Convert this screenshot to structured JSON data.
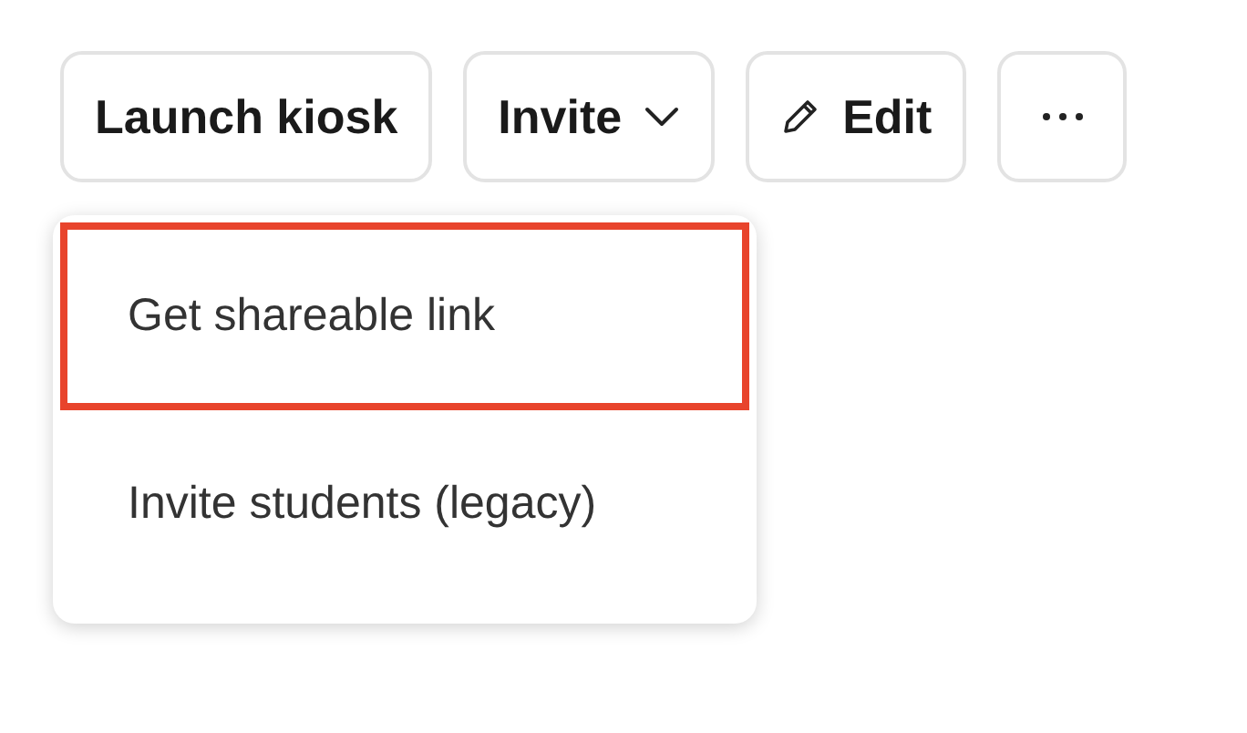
{
  "toolbar": [
    {
      "kind": "text",
      "label": "Launch kiosk"
    },
    {
      "kind": "dropdown",
      "label": "Invite"
    },
    {
      "kind": "edit",
      "label": "Edit"
    },
    {
      "kind": "more"
    }
  ],
  "menu": {
    "items": [
      {
        "label": "Get shareable link",
        "highlighted": true
      },
      {
        "label": "Invite students (legacy)",
        "highlighted": false
      }
    ]
  }
}
